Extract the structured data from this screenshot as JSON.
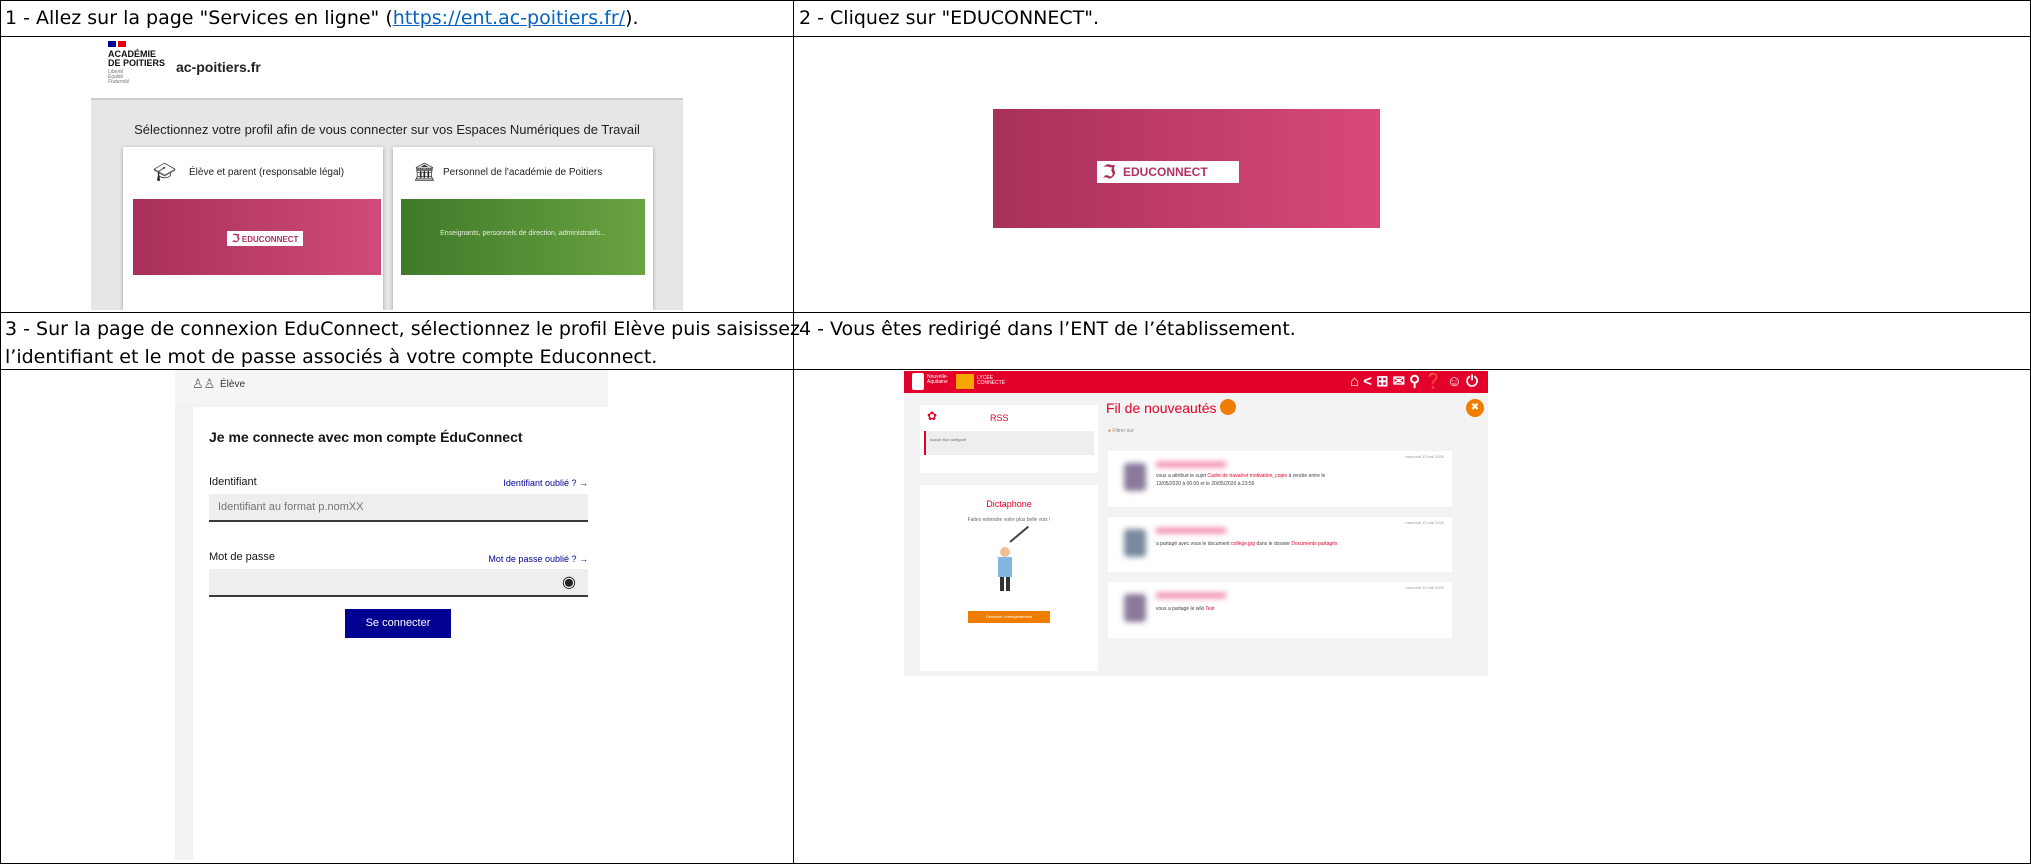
{
  "steps": [
    {
      "prefix": "1 - Allez sur la page \"Services en ligne\" (",
      "link": "https://ent.ac-poitiers.fr/",
      "suffix": ")."
    },
    {
      "text": "2 - Cliquez sur \"EDUCONNECT\"."
    },
    {
      "line1": "3 - Sur la page de connexion EduConnect, sélectionnez le profil Elève puis saisissez",
      "line2": "l’identifiant et le mot de passe associés à votre compte Educonnect."
    },
    {
      "text": "4 - Vous êtes redirigé dans l’ENT de l’établissement."
    }
  ],
  "academie": {
    "logo_line1": "ACADÉMIE",
    "logo_line2": "DE POITIERS",
    "logo_motto1": "Liberté",
    "logo_motto2": "Égalité",
    "logo_motto3": "Fraternité",
    "site": "ac-poitiers.fr",
    "headline": "Sélectionnez votre profil afin de vous connecter sur vos Espaces Numériques de Travail",
    "card_eleve": "Élève et parent (responsable légal)",
    "card_personnel": "Personnel de l'académie de Poitiers",
    "educonnect_label": "EDUCONNECT",
    "personnel_desc": "Enseignants, personnels de direction, administratifs..."
  },
  "educonnect_big": {
    "label": "EDUCONNECT"
  },
  "login": {
    "profile": "Élève",
    "title": "Je me connecte avec mon compte ÉduConnect",
    "id_label": "Identifiant",
    "id_forgot": "Identifiant oublié ?",
    "id_placeholder": "Identifiant au format p.nomXX",
    "pw_label": "Mot de passe",
    "pw_forgot": "Mot de passe oublié ?",
    "submit": "Se connecter"
  },
  "ent": {
    "region": "Nouvelle-Aquitaine",
    "lycee": "LYCÉE CONNECTÉ",
    "rss_title": "RSS",
    "rss_empty": "Aucun flux configuré",
    "feed_title": "Fil de nouveautés",
    "filter": "Filtrer sur",
    "dictaphone_title": "Dictaphone",
    "dictaphone_text": "Faites entendre votre plus belle voix !",
    "dictaphone_button": "Démarrer l'enregistrement",
    "news": [
      {
        "date": "mercredi 13 mai 2020",
        "text1": "vous a attribué le sujet ",
        "link1": "Cadre de travail et motivation_copie",
        "text2": " à rendre entre le",
        "line2": "13/05/2020 à 00:00 et le 20/05/2020 à 23:59"
      },
      {
        "date": "mercredi 13 mai 2020",
        "text1": "a partagé avec vous le document ",
        "link1": "collège.jpg",
        "text2": " dans le dossier ",
        "link2": "Documents partagés"
      },
      {
        "date": "mercredi 13 mai 2020",
        "text1": "vous a partagé le wiki ",
        "link1": "Test"
      }
    ]
  }
}
